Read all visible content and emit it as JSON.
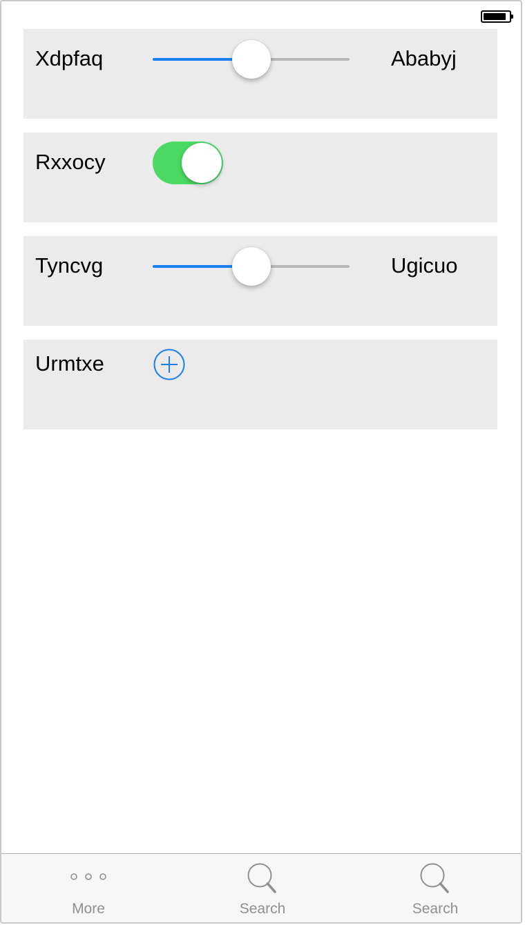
{
  "status_bar": {
    "battery_level": 0.9
  },
  "rows": [
    {
      "type": "slider",
      "label": "Xdpfaq",
      "value_label": "Ababyj",
      "slider_value": 0.5
    },
    {
      "type": "toggle",
      "label": "Rxxocy",
      "toggle_on": true
    },
    {
      "type": "slider",
      "label": "Tyncvg",
      "value_label": "Ugicuo",
      "slider_value": 0.5
    },
    {
      "type": "add",
      "label": "Urmtxe"
    }
  ],
  "tab_bar": {
    "tabs": [
      {
        "label": "More",
        "icon": "more-icon"
      },
      {
        "label": "Search",
        "icon": "search-icon"
      },
      {
        "label": "Search",
        "icon": "search-icon"
      }
    ]
  },
  "colors": {
    "accent": "#1a7ff5",
    "toggle_on": "#4cd964",
    "row_bg": "#ebebeb",
    "tab_inactive": "#8f8f8f"
  }
}
